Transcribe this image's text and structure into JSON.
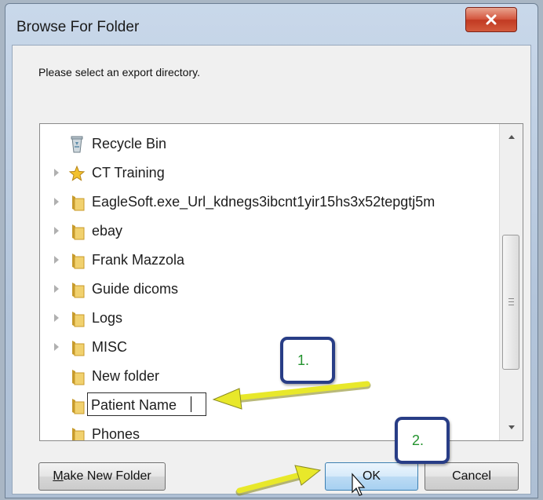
{
  "dialog": {
    "title": "Browse For Folder",
    "close_glyph": "x",
    "prompt": "Please select an export directory."
  },
  "tree": {
    "items": [
      {
        "label": "Recycle Bin",
        "icon": "recycle-bin-icon",
        "expandable": false
      },
      {
        "label": "CT Training",
        "icon": "star-icon",
        "expandable": true
      },
      {
        "label": "EagleSoft.exe_Url_kdnegs3ibcnt1yir15hs3x52tepgtj5m",
        "icon": "folder-icon",
        "expandable": true
      },
      {
        "label": "ebay",
        "icon": "folder-icon",
        "expandable": true
      },
      {
        "label": "Frank Mazzola",
        "icon": "folder-icon",
        "expandable": true
      },
      {
        "label": "Guide dicoms",
        "icon": "folder-icon",
        "expandable": true
      },
      {
        "label": "Logs",
        "icon": "folder-icon",
        "expandable": true
      },
      {
        "label": "MISC",
        "icon": "folder-icon",
        "expandable": true
      },
      {
        "label": "New folder",
        "icon": "folder-icon",
        "expandable": false
      },
      {
        "label": "Patient Name",
        "icon": "folder-icon",
        "expandable": false,
        "editing": true
      },
      {
        "label": "Phones",
        "icon": "folder-icon",
        "expandable": false
      }
    ]
  },
  "buttons": {
    "make_new_folder_accel": "M",
    "make_new_folder_rest": "ake New Folder",
    "ok": "OK",
    "cancel": "Cancel"
  },
  "annotations": {
    "step1": "1.",
    "step2": "2.",
    "callout_color": "#283d86",
    "number_color": "#23932e",
    "arrow_color": "#e8e82a"
  }
}
